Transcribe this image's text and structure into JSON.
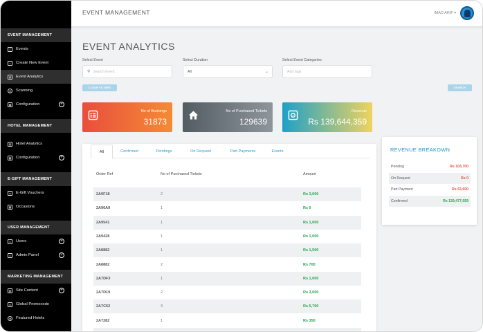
{
  "sidebar": {
    "sections": [
      {
        "title": "EVENT MANAGEMENT",
        "items": [
          {
            "label": "Events"
          },
          {
            "label": "Create New Event"
          },
          {
            "label": "Event Analytics"
          },
          {
            "label": "Scanning"
          },
          {
            "label": "Configuration"
          }
        ]
      },
      {
        "title": "HOTEL MANAGEMENT",
        "items": [
          {
            "label": "Hotel Analytics"
          },
          {
            "label": "Configuration"
          }
        ]
      },
      {
        "title": "E-GIFT MANAGEMENT",
        "items": [
          {
            "label": "E-Gift Vouchers"
          },
          {
            "label": "Occasions"
          }
        ]
      },
      {
        "title": "USER MANAGEMENT",
        "items": [
          {
            "label": "Users"
          },
          {
            "label": "Admin Panel"
          }
        ]
      },
      {
        "title": "MARKETING MANAGEMENT",
        "items": [
          {
            "label": "Site Content"
          },
          {
            "label": "Global Promocode"
          },
          {
            "label": "Featured Hotels"
          }
        ]
      }
    ],
    "active_item": "Event Analytics"
  },
  "header": {
    "title": "EVENT MANAGEMENT",
    "user_name": "IMAD ARIF"
  },
  "page": {
    "title": "EVENT ANALYTICS"
  },
  "filters": {
    "event_label": "Select Event",
    "event_placeholder": "Search Event",
    "duration_label": "Select Duration",
    "duration_value": "All",
    "categories_label": "Select Event Categories",
    "categories_placeholder": "Add tags",
    "clear_label": "CLEAR FILTERS",
    "search_label": "SEARCH"
  },
  "stats": [
    {
      "label": "No of Bookings",
      "value": "31873",
      "color_from": "#e94e3c",
      "color_to": "#f58b35",
      "icon": "list-icon"
    },
    {
      "label": "No of Purchased Tickets",
      "value": "129639",
      "color_from": "#525c63",
      "color_to": "#8e969b",
      "icon": "home-icon"
    },
    {
      "label": "Revenue",
      "value": "Rs 139,644,359",
      "color_from": "#1ea0c8",
      "color_to": "#efd35e",
      "icon": "safe-icon"
    }
  ],
  "tabs": [
    "All",
    "Confirmed",
    "Pendings",
    "On Request",
    "Part Payments",
    "Events"
  ],
  "active_tab": "All",
  "table": {
    "columns": [
      "Order Ref",
      "No of Purchased Tickets",
      "Amount"
    ],
    "rows": [
      {
        "ref": "2A9F18",
        "tickets": "2",
        "amount": "Rs 3,000"
      },
      {
        "ref": "2A96A9",
        "tickets": "1",
        "amount": "Rs 0"
      },
      {
        "ref": "2A9541",
        "tickets": "1",
        "amount": "Rs 1,000"
      },
      {
        "ref": "2A9428",
        "tickets": "1",
        "amount": "Rs 1,000"
      },
      {
        "ref": "2A8882",
        "tickets": "1",
        "amount": "Rs 1,500"
      },
      {
        "ref": "2A8882",
        "tickets": "2",
        "amount": "Rs 700"
      },
      {
        "ref": "2A7DF3",
        "tickets": "1",
        "amount": "Rs 1,000"
      },
      {
        "ref": "2A7D19",
        "tickets": "2",
        "amount": "Rs 3,000"
      },
      {
        "ref": "2A7C62",
        "tickets": "3",
        "amount": "Rs 5,700"
      },
      {
        "ref": "2A7282",
        "tickets": "1",
        "amount": "Rs 350"
      },
      {
        "ref": "2A7018",
        "tickets": "2",
        "amount": "Rs 4,000"
      }
    ]
  },
  "revenue_breakdown": {
    "title": "REVENUE BREAKOWN",
    "items": [
      {
        "label": "Pending",
        "value": "Rs 103,700",
        "color": "#e8533a"
      },
      {
        "label": "On Request",
        "value": "Rs 0",
        "color": "#e8533a"
      },
      {
        "label": "Part Payment",
        "value": "Rs 63,600",
        "color": "#e8533a"
      },
      {
        "label": "Confirmed",
        "value": "Rs 139,477,059",
        "color": "#1ea84d"
      }
    ]
  }
}
